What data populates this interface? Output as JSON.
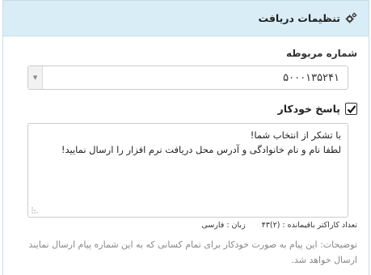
{
  "panel": {
    "title": "تنظیمات دریافت",
    "icon": "gears-icon"
  },
  "number_field": {
    "label": "شماره مربوطه",
    "value": "۵۰۰۰۱۳۵۲۴۱"
  },
  "auto_reply": {
    "checked": true,
    "label": "پاسخ خودکار",
    "message_line1": "با تشکر از انتخاب شما!",
    "message_line2": "لطفا نام و نام خانوادگی و آدرس محل دریافت نرم افزار را ارسال نمایید!"
  },
  "meta": {
    "remaining_chars": "تعداد کاراکتر باقیمانده : (۲)۴۳",
    "language": "زبان : فارسی"
  },
  "description": "توضیحات: این پیام به صورت خودکار برای تمام کسانی که به این شماره پیام ارسال نمایند ارسال خواهد شد."
}
